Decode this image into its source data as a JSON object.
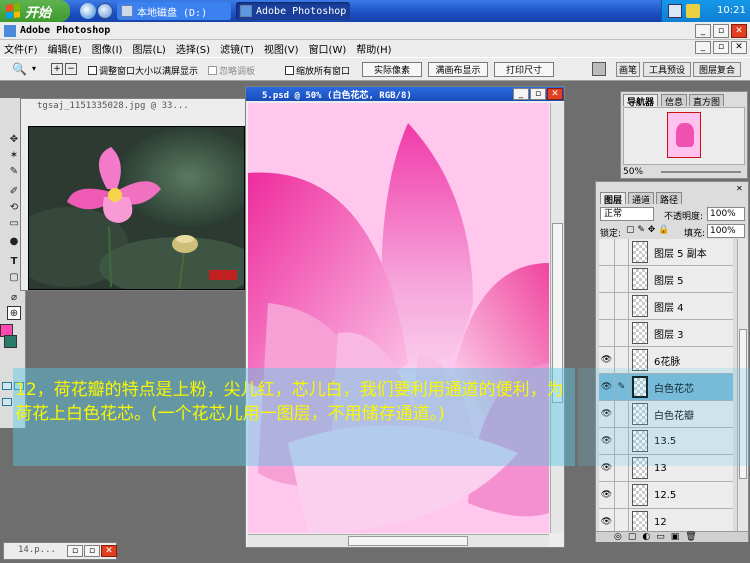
{
  "taskbar": {
    "start_label": "开始",
    "tasks": [
      {
        "label": "本地磁盘 (D:)"
      },
      {
        "label": "Adobe Photoshop"
      }
    ],
    "clock": "10:21"
  },
  "app": {
    "title": "Adobe Photoshop",
    "menu": [
      "文件(F)",
      "编辑(E)",
      "图像(I)",
      "图层(L)",
      "选择(S)",
      "滤镜(T)",
      "视图(V)",
      "窗口(W)",
      "帮助(H)"
    ]
  },
  "options": {
    "resize_label": "调整窗口大小以满屏显示",
    "ignore_palettes_label": "忽略调板",
    "zoom_all_label": "缩放所有窗口",
    "actual_pixels": "实际像素",
    "fit_screen": "满画布显示",
    "print_size": "打印尺寸",
    "palette_wells": [
      "画笔",
      "工具预设",
      "图层复合"
    ]
  },
  "documents": [
    {
      "title": "tgsaj_1151335028.jpg @ 33..."
    },
    {
      "title": "5.psd @ 50% (白色花芯, RGB/8)"
    },
    {
      "title": "14.p..."
    }
  ],
  "navigator": {
    "tabs": [
      "导航器",
      "信息",
      "直方图"
    ],
    "zoom": "50%"
  },
  "layers_panel": {
    "tabs": [
      "图层",
      "通道",
      "路径"
    ],
    "blend_mode": "正常",
    "opacity_label": "不透明度:",
    "opacity": "100%",
    "lock_label": "锁定:",
    "fill_label": "填充:",
    "fill": "100%",
    "layers": [
      {
        "name": "图层 5 副本",
        "visible": false,
        "selected": false
      },
      {
        "name": "图层 5",
        "visible": false,
        "selected": false
      },
      {
        "name": "图层 4",
        "visible": false,
        "selected": false
      },
      {
        "name": "图层 3",
        "visible": false,
        "selected": false
      },
      {
        "name": "6花脉",
        "visible": true,
        "selected": false
      },
      {
        "name": "白色花芯",
        "visible": true,
        "selected": true
      },
      {
        "name": "白色花瓣",
        "visible": true,
        "selected": false
      },
      {
        "name": "13.5",
        "visible": true,
        "selected": false
      },
      {
        "name": "13",
        "visible": true,
        "selected": false
      },
      {
        "name": "12.5",
        "visible": true,
        "selected": false
      },
      {
        "name": "12",
        "visible": true,
        "selected": false
      }
    ]
  },
  "caption": "12，荷花瓣的特点是上粉，尖儿红，芯儿白，我们要利用通道的便利，为荷花上白色花芯。(一个花芯儿用一图层，不用储存通道。)",
  "colors": {
    "accent": "#ff40a0",
    "caption": "#f8f800",
    "selection": "#7fb8d8"
  }
}
